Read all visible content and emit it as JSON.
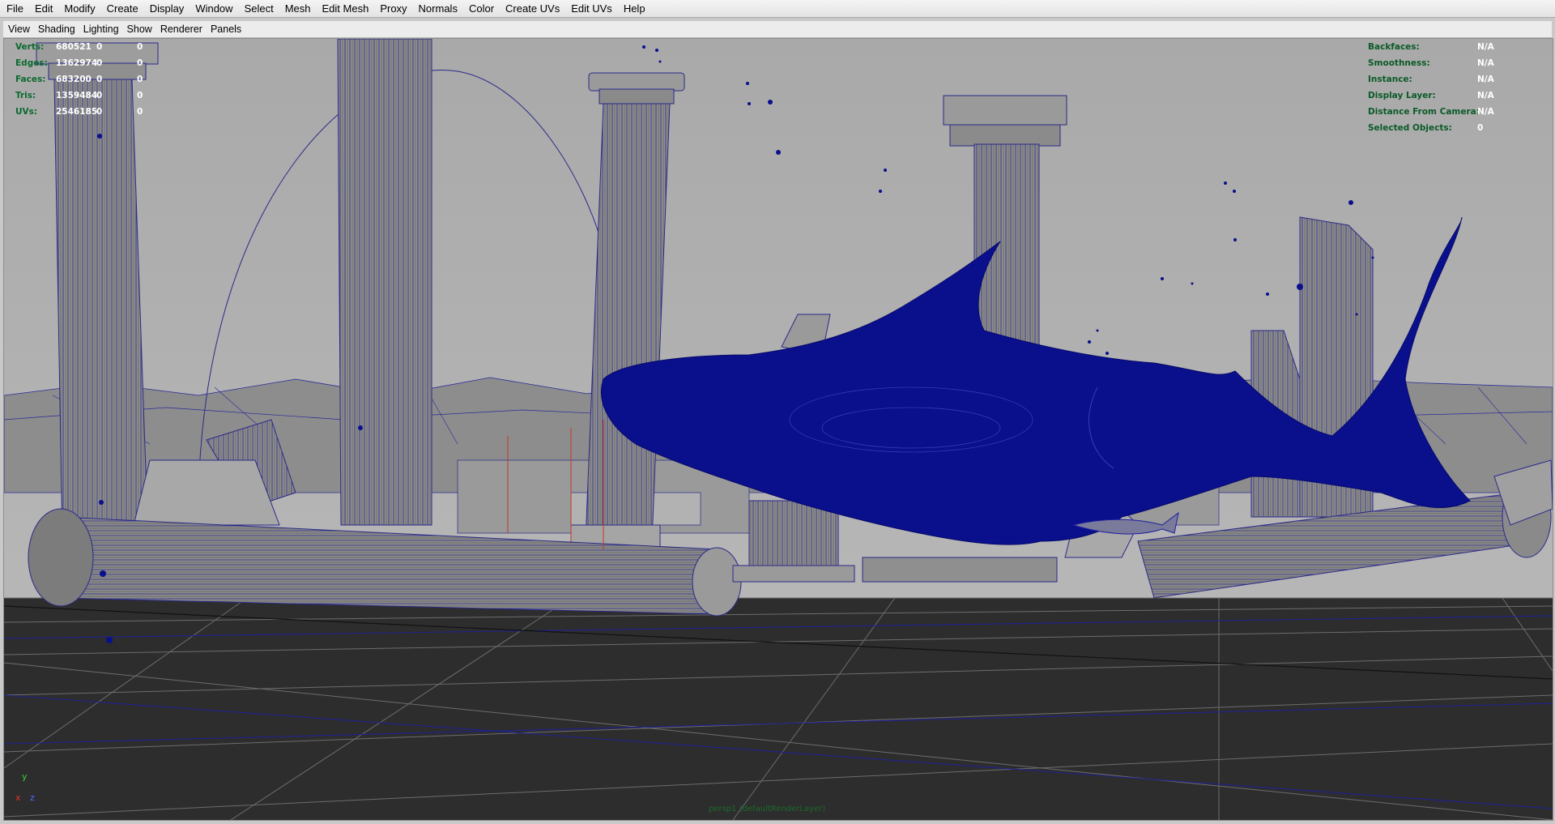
{
  "menu": [
    "File",
    "Edit",
    "Modify",
    "Create",
    "Display",
    "Window",
    "Select",
    "Mesh",
    "Edit Mesh",
    "Proxy",
    "Normals",
    "Color",
    "Create UVs",
    "Edit UVs",
    "Help"
  ],
  "panel_menu": [
    "View",
    "Shading",
    "Lighting",
    "Show",
    "Renderer",
    "Panels"
  ],
  "hud_stats": [
    {
      "label": "Verts:",
      "v1": "680521",
      "v2": "0",
      "v3": "0"
    },
    {
      "label": "Edges:",
      "v1": "1362974",
      "v2": "0",
      "v3": "0"
    },
    {
      "label": "Faces:",
      "v1": "683200",
      "v2": "0",
      "v3": "0"
    },
    {
      "label": "Tris:",
      "v1": "1359484",
      "v2": "0",
      "v3": "0"
    },
    {
      "label": "UVs:",
      "v1": "2546185",
      "v2": "0",
      "v3": "0"
    }
  ],
  "hud_info": [
    {
      "label": "Backfaces:",
      "value": "N/A"
    },
    {
      "label": "Smoothness:",
      "value": "N/A"
    },
    {
      "label": "Instance:",
      "value": "N/A"
    },
    {
      "label": "Display Layer:",
      "value": "N/A"
    },
    {
      "label": "Distance From Camera:",
      "value": "N/A"
    },
    {
      "label": "Selected Objects:",
      "value": "0"
    }
  ],
  "axis": {
    "x": "x",
    "y": "y",
    "z": "z"
  },
  "camera_label": "persp1 (defaultRenderLayer)",
  "colors": {
    "shark": "#0a0f8c",
    "wire": "#1c1fa0",
    "ground": "#2d2d2d",
    "sky": "#b5b5b5"
  }
}
